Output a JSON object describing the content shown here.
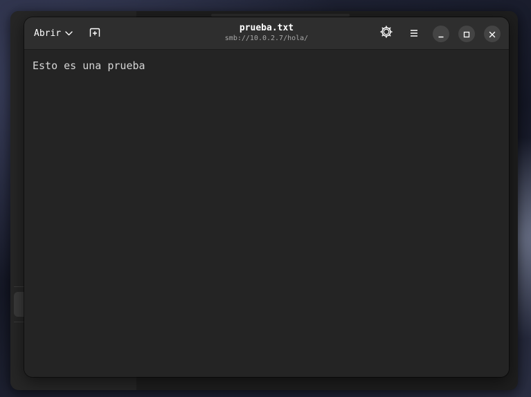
{
  "window": {
    "title": "prueba.txt",
    "subtitle": "smb://10.0.2.7/hola/"
  },
  "headerbar": {
    "open_label": "Abrir",
    "open_icon": "chevron-down-icon",
    "new_tab_icon": "new-tab-icon",
    "settings_icon": "gear-icon",
    "menu_icon": "hamburger-menu-icon",
    "minimize_icon": "minimize-icon",
    "maximize_icon": "maximize-icon",
    "close_icon": "close-icon"
  },
  "document": {
    "content": "Esto es una prueba"
  },
  "colors": {
    "headerbar_bg": "#2e2e2e",
    "editor_bg": "#242424",
    "text": "#d6d6d6",
    "window_button_bg": "#444444"
  }
}
